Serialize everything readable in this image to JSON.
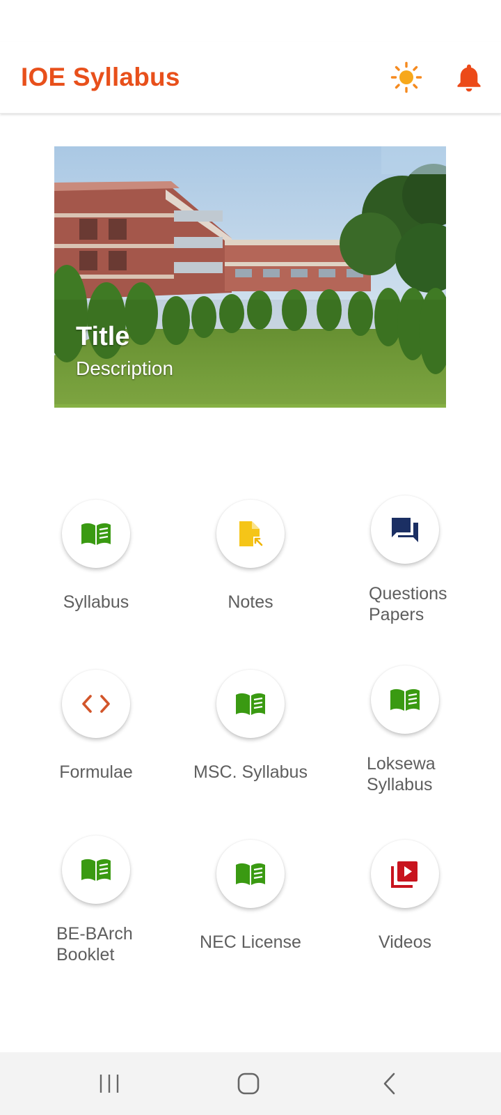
{
  "app": {
    "title": "IOE Syllabus",
    "accent_color": "#e8501b",
    "icons": {
      "theme": "sun-icon",
      "notifications": "bell-icon"
    }
  },
  "banner": {
    "title": "Title",
    "description": "Description"
  },
  "menu": {
    "items": [
      {
        "label": "Syllabus",
        "icon": "book-icon",
        "color": "#3a9a12"
      },
      {
        "label": "Notes",
        "icon": "file-icon",
        "color": "#f5c518"
      },
      {
        "label": "Questions Papers",
        "label_lines": [
          "Questions",
          "Papers"
        ],
        "icon": "forum-icon",
        "color": "#1b2f63"
      },
      {
        "label": "Formulae",
        "icon": "code-icon",
        "color": "#d2552a"
      },
      {
        "label": "MSC. Syllabus",
        "icon": "book-icon",
        "color": "#3a9a12"
      },
      {
        "label": "Loksewa Syllabus",
        "label_lines": [
          "Loksewa",
          "Syllabus"
        ],
        "icon": "book-icon",
        "color": "#3a9a12"
      },
      {
        "label": "BE-BArch Booklet",
        "label_lines": [
          "BE-BArch",
          "Booklet"
        ],
        "icon": "book-icon",
        "color": "#3a9a12"
      },
      {
        "label": "NEC License",
        "icon": "book-icon",
        "color": "#3a9a12"
      },
      {
        "label": "Videos",
        "icon": "video-library-icon",
        "color": "#c8141e"
      }
    ]
  },
  "nav": {
    "recents": "recents-icon",
    "home": "home-icon",
    "back": "back-icon"
  }
}
